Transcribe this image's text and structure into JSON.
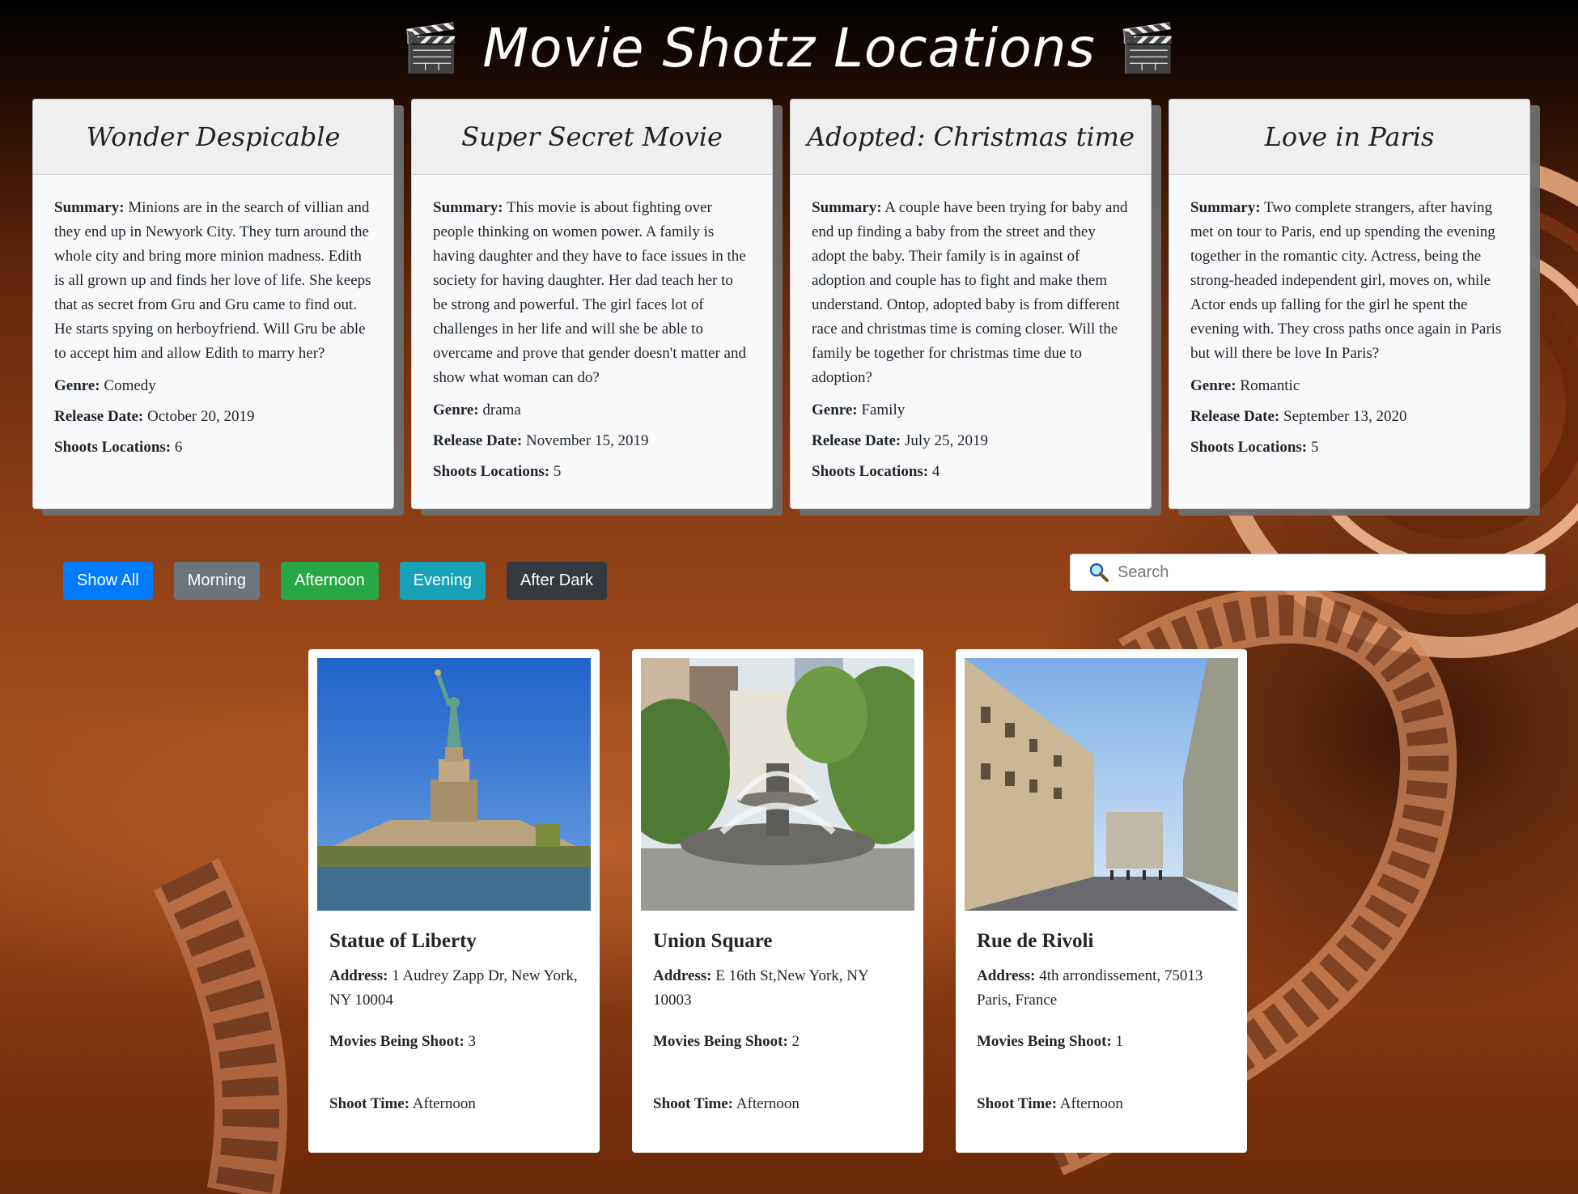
{
  "header": {
    "title": "Movie Shotz Locations",
    "clapper_icon": "🎬"
  },
  "labels": {
    "summary": "Summary:",
    "genre": "Genre:",
    "release_date": "Release Date:",
    "shoots_locations": "Shoots Locations:",
    "address": "Address:",
    "movies_being_shoot": "Movies Being Shoot:",
    "shoot_time": "Shoot Time:"
  },
  "movies": [
    {
      "title": "Wonder Despicable",
      "summary": "Minions are in the search of villian and they end up in Newyork City. They turn around the whole city and bring more minion madness. Edith is all grown up and finds her love of life. She keeps that as secret from Gru and Gru came to find out. He starts spying on herboyfriend. Will Gru be able to accept him and allow Edith to marry her?",
      "genre": "Comedy",
      "release_date": "October 20, 2019",
      "shoots_locations": "6"
    },
    {
      "title": "Super Secret Movie",
      "summary": "This movie is about fighting over people thinking on women power. A family is having daughter and they have to face issues in the society for having daughter. Her dad teach her to be strong and powerful. The girl faces lot of challenges in her life and will she be able to overcame and prove that gender doesn't matter and show what woman can do?",
      "genre": "drama",
      "release_date": "November 15, 2019",
      "shoots_locations": "5"
    },
    {
      "title": "Adopted: Christmas time",
      "summary": "A couple have been trying for baby and end up finding a baby from the street and they adopt the baby. Their family is in against of adoption and couple has to fight and make them understand. Ontop, adopted baby is from different race and christmas time is coming closer. Will the family be together for christmas time due to adoption?",
      "genre": "Family",
      "release_date": "July 25, 2019",
      "shoots_locations": "4"
    },
    {
      "title": "Love in Paris",
      "summary": "Two complete strangers, after having met on tour to Paris, end up spending the evening together in the romantic city. Actress, being the strong-headed independent girl, moves on, while Actor ends up falling for the girl he spent the evening with. They cross paths once again in Paris but will there be love In Paris?",
      "genre": "Romantic",
      "release_date": "September 13, 2020",
      "shoots_locations": "5"
    }
  ],
  "filters": {
    "show_all": "Show All",
    "morning": "Morning",
    "afternoon": "Afternoon",
    "evening": "Evening",
    "after_dark": "After Dark"
  },
  "search": {
    "placeholder": "Search",
    "icon": "magnifying-glass-icon"
  },
  "locations": [
    {
      "name": "Statue of Liberty",
      "address": "1 Audrey Zapp Dr, New York, NY 10004",
      "movies_being_shoot": "3",
      "shoot_time": "Afternoon"
    },
    {
      "name": "Union Square",
      "address": "E 16th St,New York, NY 10003",
      "movies_being_shoot": "2",
      "shoot_time": "Afternoon"
    },
    {
      "name": "Rue de Rivoli",
      "address": "4th arrondissement, 75013 Paris, France",
      "movies_being_shoot": "1",
      "shoot_time": "Afternoon"
    }
  ],
  "colors": {
    "show_all": "#007bff",
    "morning": "#6c757d",
    "afternoon": "#28a745",
    "evening": "#17a2b8",
    "after_dark": "#343a40"
  }
}
